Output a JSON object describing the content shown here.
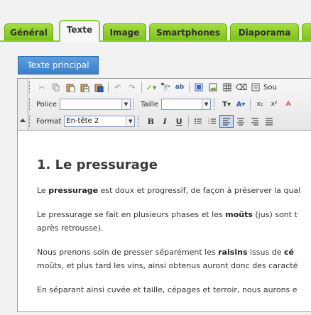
{
  "tabs": [
    {
      "label": "Général"
    },
    {
      "label": "Texte"
    },
    {
      "label": "Image"
    },
    {
      "label": "Smartphones"
    },
    {
      "label": "Diaporama"
    }
  ],
  "section_button": "Texte principal",
  "toolbar": {
    "row1_icons": [
      "cut-icon",
      "copy-icon",
      "paste-icon",
      "paste-text-icon",
      "paste-word-icon",
      "undo-icon",
      "redo-icon",
      "spellcheck-icon",
      "find-icon",
      "replace-icon",
      "select-all-icon",
      "table-icon",
      "image-icon",
      "hr-icon",
      "special-char-icon",
      "remove-format-icon",
      "source-icon"
    ],
    "source_label": "Sou",
    "police_label": "Police",
    "police_value": "",
    "taille_label": "Taille",
    "taille_value": "",
    "format_label": "Format",
    "format_value": "En-tête 2"
  },
  "content": {
    "title": "1. Le pressurage",
    "p1": {
      "t1": "Le ",
      "b1": "pressurage",
      "t2": " est doux et progressif, de façon à préserver la qual"
    },
    "p2": {
      "l1a": "Le pressurage se fait en plusieurs phases et les ",
      "b1": "moûts",
      "l1b": " (jus) sont t",
      "l2": "après retrousse)."
    },
    "p3": {
      "l1a": "Nous prenons soin de presser séparément les ",
      "b1": "raisins",
      "l1b": " issus de ",
      "b2": "cé",
      "l2": "moûts, et plus tard les vins, ainsi obtenus auront donc des caracté"
    },
    "p4": {
      "l1": "En séparant ainsi cuvée et taille, cépages et terroir, nous aurons e"
    }
  }
}
